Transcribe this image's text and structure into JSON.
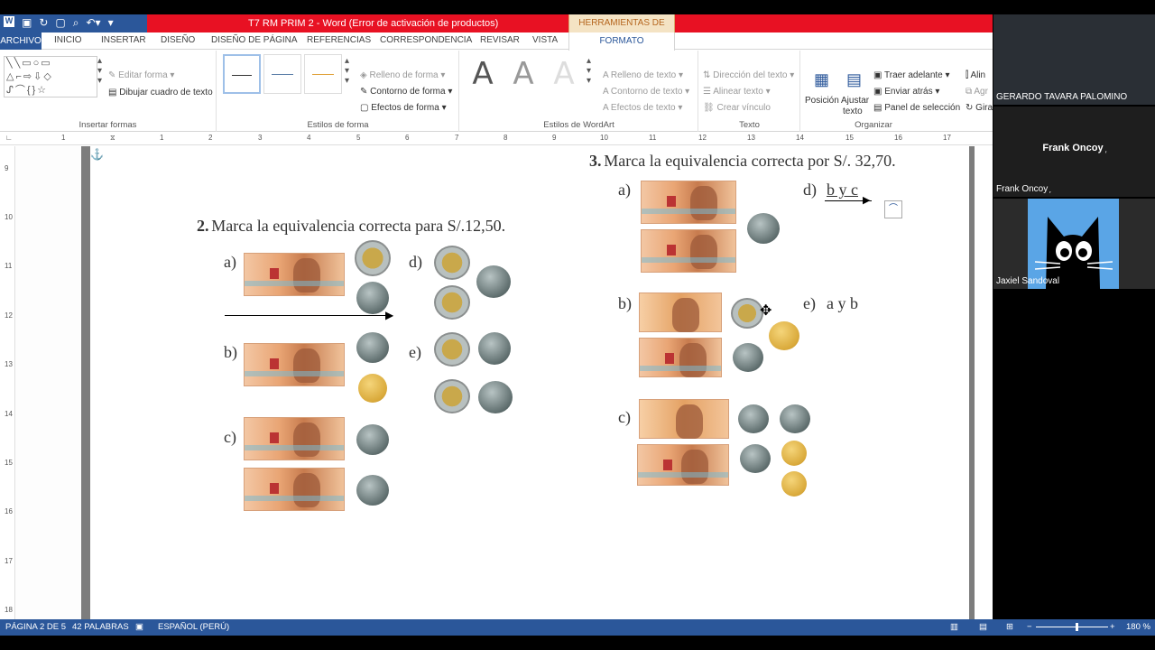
{
  "window": {
    "title": "T7 RM PRIM 2 -  Word (Error de activación de productos)",
    "context_tab": "HERRAMIENTAS DE DIBUJO"
  },
  "tabs": [
    "ARCHIVO",
    "INICIO",
    "INSERTAR",
    "DISEÑO",
    "DISEÑO DE PÁGINA",
    "REFERENCIAS",
    "CORRESPONDENCIA",
    "REVISAR",
    "VISTA",
    "FORMATO"
  ],
  "ribbon": {
    "insertar_formas": {
      "label": "Insertar formas",
      "editar_forma": "Editar forma",
      "dibujar_cuadro": "Dibujar cuadro de texto"
    },
    "estilos_forma": {
      "label": "Estilos de forma",
      "relleno": "Relleno de forma",
      "contorno": "Contorno de forma",
      "efectos": "Efectos de forma"
    },
    "wordart": {
      "label": "Estilos de WordArt",
      "relleno": "Relleno de texto",
      "contorno": "Contorno de texto",
      "efectos": "Efectos de texto"
    },
    "texto": {
      "label": "Texto",
      "direccion": "Dirección del texto",
      "alinear": "Alinear texto",
      "crear_vinculo": "Crear vínculo"
    },
    "organizar": {
      "label": "Organizar",
      "posicion": "Posición",
      "ajustar": "Ajustar",
      "ajustar2": "texto",
      "traer": "Traer adelante",
      "enviar": "Enviar atrás",
      "panel": "Panel de selección",
      "alin": "Alin",
      "agr": "Agr",
      "gira": "Gira"
    }
  },
  "ruler": {
    "h_ticks": [
      "1",
      "1",
      "2",
      "3",
      "4",
      "5",
      "6",
      "7",
      "8",
      "9",
      "10",
      "11",
      "12",
      "13",
      "14",
      "15",
      "16",
      "17"
    ],
    "v_ticks": [
      "9",
      "10",
      "11",
      "12",
      "13",
      "14",
      "15",
      "16",
      "17",
      "18"
    ]
  },
  "document": {
    "q2": {
      "number": "2.",
      "text": "Marca la equivalencia correcta para S/.12,50.",
      "options": [
        "a)",
        "b)",
        "c)",
        "d)",
        "e)"
      ]
    },
    "q3": {
      "number": "3.",
      "text": "Marca la equivalencia correcta por S/. 32,70.",
      "options": [
        "a)",
        "b)",
        "c)"
      ],
      "answer_d": "d)",
      "answer_d_text": "b y c",
      "answer_e": "e)",
      "answer_e_text": "a y b"
    }
  },
  "status": {
    "page": "PÁGINA 2 DE 5",
    "words": "42 PALABRAS",
    "language": "ESPAÑOL (PERÚ)",
    "zoom": "180 %"
  },
  "participants": [
    {
      "name": "GERARDO TAVARA PALOMINO"
    },
    {
      "name": "Frank Oncoy ᷊",
      "center": "Frank  Oncoy ᷊"
    },
    {
      "name": "Jaxiel Sandoval"
    }
  ]
}
